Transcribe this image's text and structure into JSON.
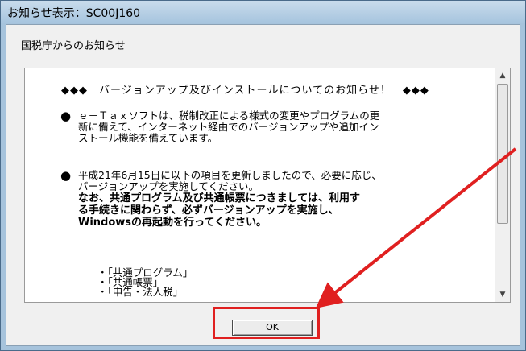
{
  "window": {
    "title": "お知らせ表示：SC00J160"
  },
  "heading": "国税庁からのお知らせ",
  "notice": {
    "title_line": "◆◆◆　バージョンアップ及びインストールについてのお知らせ！　◆◆◆",
    "bullet_1": [
      "ｅ－Ｔａｘソフトは、税制改正による様式の変更やプログラムの更",
      "新に備えて、インターネット経由でのバージョンアップや追加イン",
      "ストール機能を備えています。"
    ],
    "bullet_2": [
      "平成21年6月15日に以下の項目を更新しましたので、必要に応じ、",
      "バージョンアップを実施してください。"
    ],
    "bullet_2_bold": [
      "なお、共通プログラム及び共通帳票につきましては、利用す",
      "る手続きに関わらず、必ずバージョンアップを実施し、",
      "Windowsの再起動を行ってください。"
    ],
    "items": [
      "・「共通プログラム」",
      "・「共通帳票」",
      "・「申告・法人税」"
    ]
  },
  "buttons": {
    "ok": "OK"
  },
  "icons": {
    "scroll_up": "scroll-up-arrow",
    "scroll_down": "scroll-down-arrow",
    "bullet": "black-circle"
  },
  "colors": {
    "highlight": "#e02020",
    "arrow": "#e02020"
  }
}
